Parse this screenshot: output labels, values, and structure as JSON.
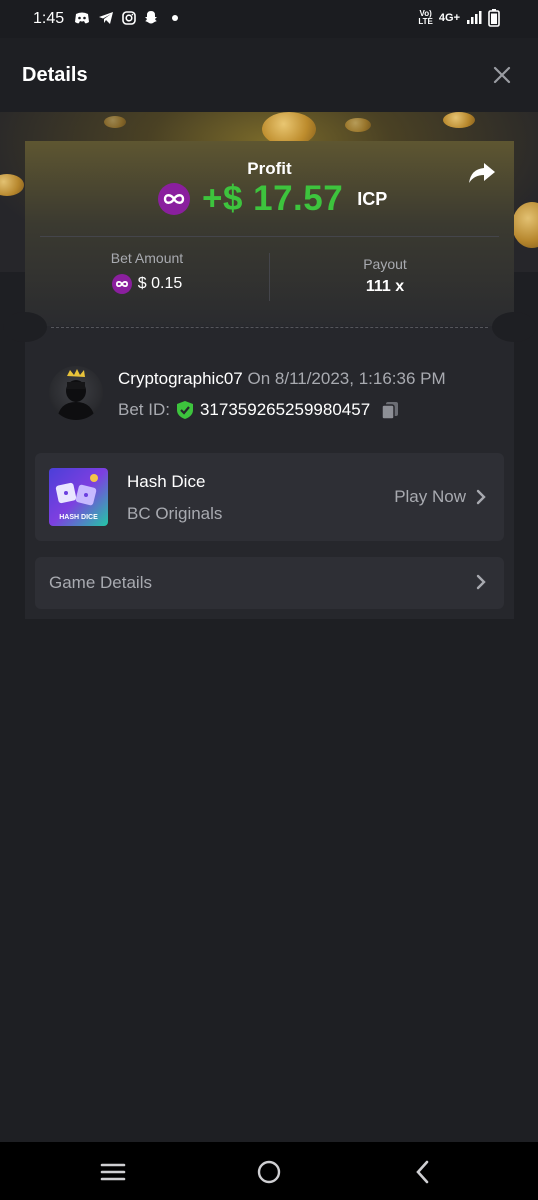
{
  "status_bar": {
    "time": "1:45",
    "network": "4G+",
    "icons": [
      "discord-icon",
      "telegram-icon",
      "instagram-icon",
      "snapchat-icon",
      "dot-icon",
      "volte-icon",
      "signal-icon",
      "battery-icon"
    ]
  },
  "header": {
    "title": "Details",
    "close_icon": "close-icon"
  },
  "profit": {
    "label": "Profit",
    "value": "+$ 17.57",
    "currency": "ICP",
    "color": "#3dc43d"
  },
  "bet": {
    "amount_label": "Bet Amount",
    "amount_value": "$ 0.15",
    "payout_label": "Payout",
    "payout_value": "111 x"
  },
  "user": {
    "name": "Cryptographic07",
    "date": "On 8/11/2023, 1:16:36 PM",
    "bet_id_label": "Bet ID:",
    "bet_id": "317359265259980457"
  },
  "game": {
    "name": "Hash Dice",
    "provider": "BC Originals",
    "play_label": "Play Now",
    "thumb_text": "HASH DICE"
  },
  "game_details": {
    "label": "Game Details"
  },
  "colors": {
    "accent_green": "#3dc43d",
    "icp_purple": "#8a1f9e",
    "background": "#1e1f23"
  }
}
